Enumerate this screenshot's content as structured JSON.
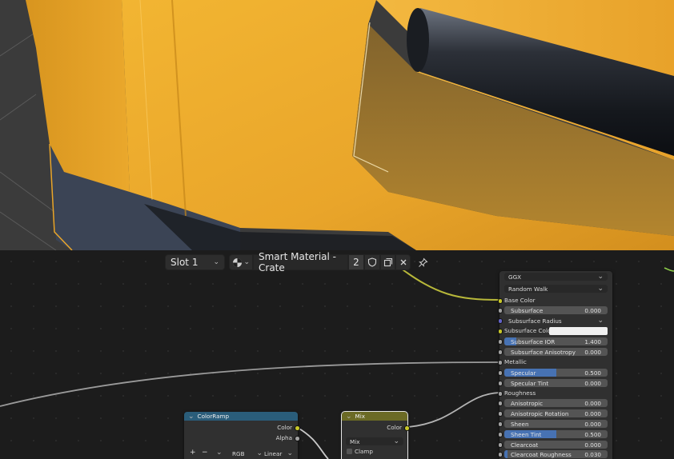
{
  "header": {
    "slot_label": "Slot 1",
    "material_name": "Smart Material - Crate",
    "user_count": "2"
  },
  "icons": {
    "browse": "material-sphere-icon",
    "fake_user": "shield-icon",
    "duplicate": "duplicate-icon",
    "unlink": "close-icon",
    "pin": "pin-icon"
  },
  "bsdf": {
    "distribution": "GGX",
    "subsurface_method": "Random Walk",
    "base_color_label": "Base Color",
    "subsurface": {
      "label": "Subsurface",
      "value": "0.000"
    },
    "subsurface_radius_label": "Subsurface Radius",
    "subsurface_color_label": "Subsurface Colo",
    "subsurface_ior": {
      "label": "Subsurface IOR",
      "value": "1.400"
    },
    "subsurface_anisotropy": {
      "label": "Subsurface Anisotropy",
      "value": "0.000"
    },
    "metallic_label": "Metallic",
    "specular": {
      "label": "Specular",
      "value": "0.500"
    },
    "specular_tint": {
      "label": "Specular Tint",
      "value": "0.000"
    },
    "roughness_label": "Roughness",
    "anisotropic": {
      "label": "Anisotropic",
      "value": "0.000"
    },
    "anisotropic_rotation": {
      "label": "Anisotropic Rotation",
      "value": "0.000"
    },
    "sheen": {
      "label": "Sheen",
      "value": "0.000"
    },
    "sheen_tint": {
      "label": "Sheen Tint",
      "value": "0.500"
    },
    "clearcoat": {
      "label": "Clearcoat",
      "value": "0.000"
    },
    "clearcoat_roughness": {
      "label": "Clearcoat Roughness",
      "value": "0.030"
    }
  },
  "colorramp": {
    "title": "ColorRamp",
    "out_color": "Color",
    "out_alpha": "Alpha",
    "add": "+",
    "remove": "−",
    "color_mode": "RGB",
    "interpolation": "Linear"
  },
  "mix": {
    "title": "Mix",
    "out_color": "Color",
    "blend_type": "Mix",
    "clamp_label": "Clamp"
  },
  "colors": {
    "crate_yellow": "#e9a52a",
    "socket_color": "#c7c729",
    "socket_float": "#a1a1a1",
    "socket_vector": "#6363c7",
    "slider_fill": "#4772b3",
    "colorramp_header": "#2a5d7a",
    "mix_header": "#6b6a25"
  }
}
